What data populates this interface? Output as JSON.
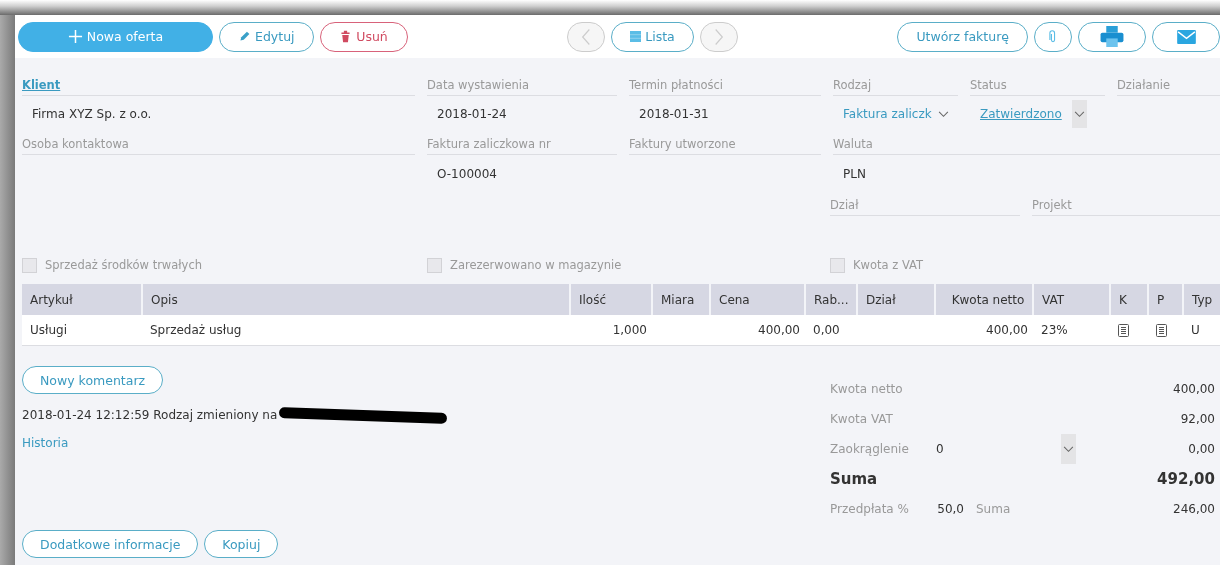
{
  "toolbar": [
    {
      "kind": "new",
      "label": "Nowa oferta",
      "disabled": false
    },
    {
      "kind": "edit",
      "label": "Edytuj",
      "disabled": false
    },
    {
      "kind": "delete",
      "label": "Usuń",
      "disabled": false
    },
    {
      "kind": "spacer"
    },
    {
      "kind": "prev",
      "disabled": true
    },
    {
      "kind": "list",
      "label": "Lista",
      "disabled": false
    },
    {
      "kind": "next",
      "disabled": true
    },
    {
      "kind": "spacer"
    },
    {
      "kind": "invoice",
      "label": "Utwórz fakturę",
      "disabled": false
    },
    {
      "kind": "attach",
      "disabled": false
    },
    {
      "kind": "print",
      "disabled": false
    },
    {
      "kind": "mail",
      "disabled": false
    }
  ],
  "field_rows": [
    [
      {
        "label": "Klient",
        "kind": "link-label",
        "value": "Firma XYZ Sp. z o.o."
      },
      {
        "label": "Data wystawienia",
        "kind": "text",
        "value": "2018-01-24"
      },
      {
        "label": "Termin płatności",
        "kind": "text",
        "value": "2018-01-31"
      },
      {
        "label": "Rodzaj",
        "kind": "select",
        "value": "Faktura zaliczk"
      },
      {
        "label": "Status",
        "kind": "link-select",
        "value": "Zatwierdzono"
      },
      {
        "label": "Działanie",
        "kind": "text"
      }
    ],
    [
      {
        "label": "Osoba kontaktowa",
        "kind": "text"
      },
      {
        "label": "Faktura zaliczkowa nr",
        "kind": "text",
        "value": "O-100004"
      },
      {
        "label": "Faktury utworzone",
        "kind": "text"
      },
      {
        "label": "Waluta",
        "kind": "text",
        "value": "PLN"
      }
    ],
    [
      {
        "label": "Dział",
        "kind": "text"
      },
      {
        "label": "Projekt",
        "kind": "text"
      }
    ]
  ],
  "checkboxes": [
    {
      "label": "Sprzedaż środków trwałych",
      "checked": false
    },
    {
      "label": "Zarezerwowano w magazynie",
      "checked": false
    },
    {
      "label": "Kwota z VAT",
      "checked": false
    }
  ],
  "table": {
    "columns": [
      {
        "label": "Artykuł"
      },
      {
        "label": "Opis"
      },
      {
        "label": "Ilość"
      },
      {
        "label": "Miara"
      },
      {
        "label": "Cena"
      },
      {
        "label": "Rab..."
      },
      {
        "label": "Dział"
      },
      {
        "label": "Kwota netto"
      },
      {
        "label": "VAT"
      },
      {
        "label": "K"
      },
      {
        "label": "P"
      },
      {
        "label": "Typ"
      }
    ],
    "rows": [
      [
        {
          "kind": "text",
          "text": "Usługi"
        },
        {
          "kind": "text",
          "text": "Sprzedaż usług"
        },
        {
          "kind": "num",
          "text": "1,000"
        },
        {
          "kind": "text"
        },
        {
          "kind": "num",
          "text": "400,00"
        },
        {
          "kind": "text",
          "text": "0,00"
        },
        {
          "kind": "text"
        },
        {
          "kind": "num",
          "text": "400,00"
        },
        {
          "kind": "text",
          "text": "23%"
        },
        {
          "kind": "doc"
        },
        {
          "kind": "doc"
        },
        {
          "kind": "text",
          "text": "U"
        }
      ]
    ]
  },
  "comment_button": "Nowy komentarz",
  "comment": {
    "text": "2018-01-24 12:12:59 Rodzaj zmieniony na",
    "redacted": true
  },
  "history_link": "Historia",
  "bottom_buttons": [
    "Dodatkowe informacje",
    "Kopiuj"
  ],
  "totals": [
    {
      "kind": "plain",
      "label": "Kwota netto",
      "value": "400,00"
    },
    {
      "kind": "plain",
      "label": "Kwota VAT",
      "value": "92,00"
    },
    {
      "kind": "select",
      "label": "Zaokrąglenie",
      "input": "0",
      "value": "0,00"
    },
    {
      "kind": "total",
      "label": "Suma",
      "value": "492,00"
    },
    {
      "kind": "prepay",
      "label": "Przedpłata %",
      "input": "50,0",
      "label2": "Suma",
      "value": "246,00"
    }
  ]
}
